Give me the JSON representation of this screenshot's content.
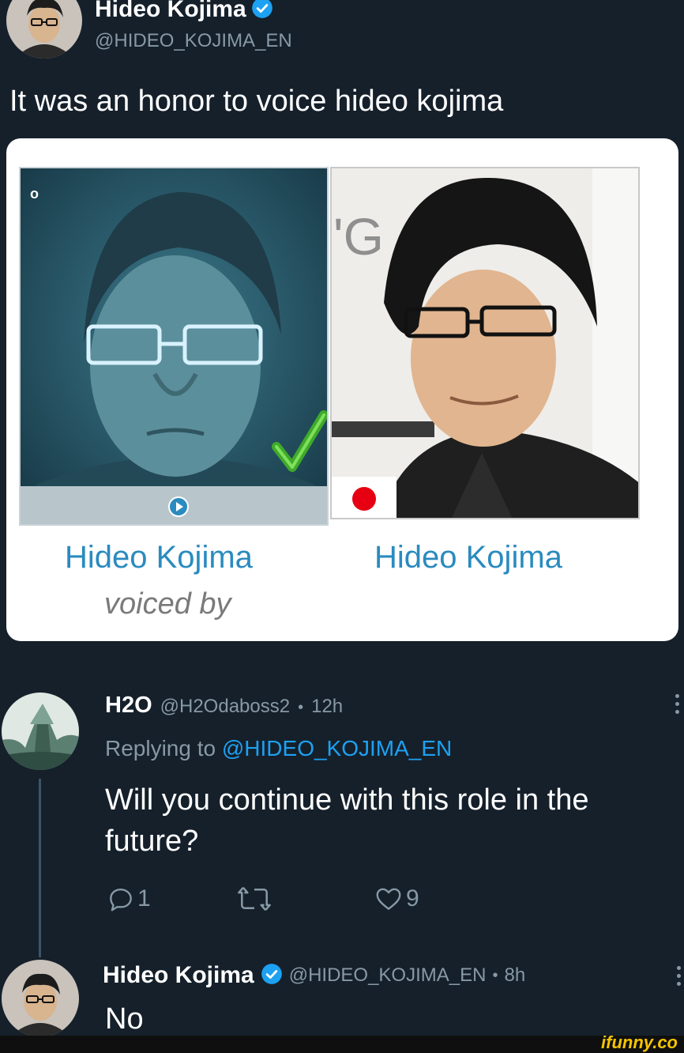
{
  "tweet": {
    "author_name": "Hideo Kojima",
    "author_handle": "@HIDEO_KOJIMA_EN",
    "text": "It was an honor to voice hideo kojima"
  },
  "media": {
    "left_caption": "Hideo Kojima",
    "left_subcaption": "voiced by",
    "right_caption": "Hideo Kojima",
    "left_panel_mark": "o",
    "right_panel_sign": "'G"
  },
  "reply": {
    "author_name": "H2O",
    "author_handle": "@H2Odaboss2",
    "separator": "•",
    "time": "12h",
    "replying_prefix": "Replying to",
    "replying_handle": "@HIDEO_KOJIMA_EN",
    "text": "Will you continue with this role in the future?",
    "reply_count": "1",
    "like_count": "9"
  },
  "answer": {
    "author_name": "Hideo Kojima",
    "author_handle": "@HIDEO_KOJIMA_EN",
    "separator": "•",
    "time": "8h",
    "text": "No"
  },
  "watermark": "ifunny.co",
  "colors": {
    "background": "#15202b",
    "link": "#1da1f2",
    "verified": "#1da1f2",
    "muted": "#8899a6",
    "caption_blue": "#2a8bbf"
  }
}
